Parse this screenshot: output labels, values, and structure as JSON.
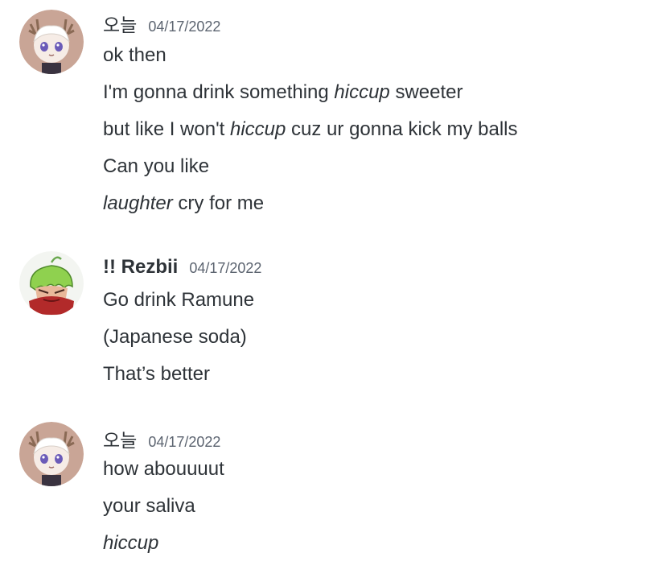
{
  "messages": [
    {
      "author": "오늘",
      "timestamp": "04/17/2022",
      "avatar": "antlered-character-avatar",
      "lines": [
        [
          {
            "t": "ok then",
            "i": false
          }
        ],
        [
          {
            "t": "I'm gonna drink something ",
            "i": false
          },
          {
            "t": "hiccup",
            "i": true
          },
          {
            "t": " sweeter",
            "i": false
          }
        ],
        [
          {
            "t": "but like I won't ",
            "i": false
          },
          {
            "t": "hiccup",
            "i": true
          },
          {
            "t": " cuz ur gonna kick my balls",
            "i": false
          }
        ],
        [
          {
            "t": "Can you like",
            "i": false
          }
        ],
        [
          {
            "t": "laughter",
            "i": true
          },
          {
            "t": " cry for me",
            "i": false
          }
        ]
      ]
    },
    {
      "author": "!! Rezbii",
      "timestamp": "04/17/2022",
      "avatar": "green-haired-character-avatar",
      "lines": [
        [
          {
            "t": "Go drink Ramune",
            "i": false
          }
        ],
        [
          {
            "t": "(Japanese soda)",
            "i": false
          }
        ],
        [
          {
            "t": "That’s better",
            "i": false
          }
        ]
      ]
    },
    {
      "author": "오늘",
      "timestamp": "04/17/2022",
      "avatar": "antlered-character-avatar",
      "lines": [
        [
          {
            "t": "how abouuuut",
            "i": false
          }
        ],
        [
          {
            "t": "your saliva",
            "i": false
          }
        ],
        [
          {
            "t": "hiccup",
            "i": true
          }
        ]
      ]
    }
  ]
}
